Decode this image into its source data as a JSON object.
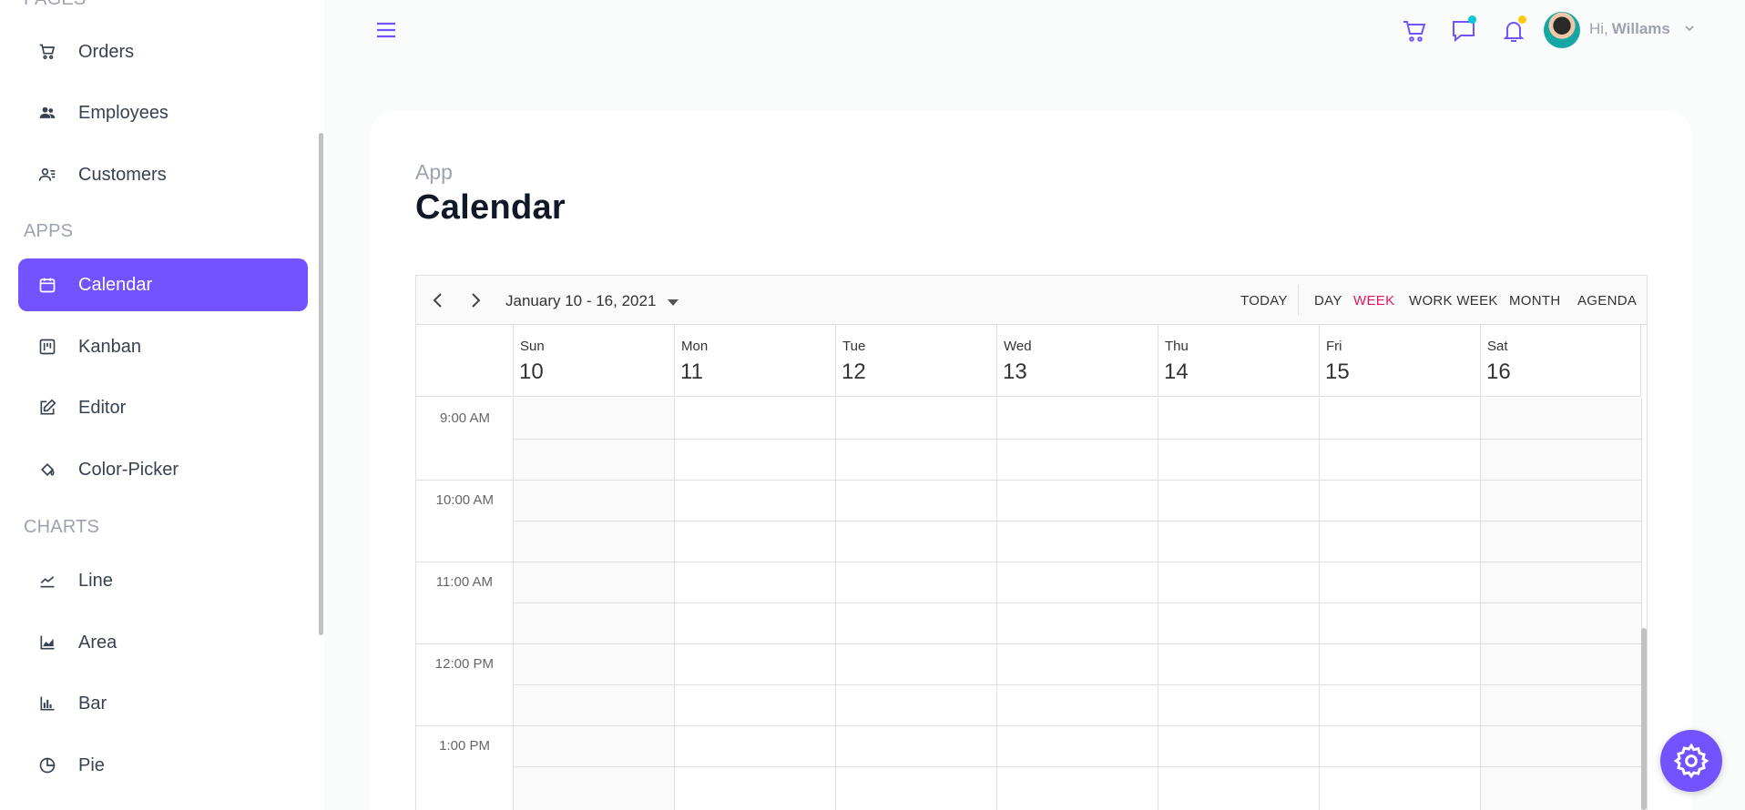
{
  "sidebar": {
    "sections": {
      "pages": "PAGES",
      "apps": "APPS",
      "charts": "CHARTS"
    },
    "items": [
      {
        "label": "Orders",
        "icon": "cart-icon"
      },
      {
        "label": "Employees",
        "icon": "employees-icon"
      },
      {
        "label": "Customers",
        "icon": "customers-icon"
      },
      {
        "label": "Calendar",
        "icon": "calendar-icon",
        "active": true
      },
      {
        "label": "Kanban",
        "icon": "kanban-icon"
      },
      {
        "label": "Editor",
        "icon": "edit-icon"
      },
      {
        "label": "Color-Picker",
        "icon": "color-picker-icon"
      },
      {
        "label": "Line",
        "icon": "line-chart-icon"
      },
      {
        "label": "Area",
        "icon": "area-chart-icon"
      },
      {
        "label": "Bar",
        "icon": "bar-chart-icon"
      },
      {
        "label": "Pie",
        "icon": "pie-chart-icon"
      }
    ]
  },
  "topbar": {
    "greeting": "Hi,",
    "user_name": "Willams",
    "chat_dot_color": "#03c9d7",
    "notification_dot_color": "#fec90f"
  },
  "page": {
    "breadcrumb": "App",
    "title": "Calendar"
  },
  "scheduler": {
    "date_range": "January 10 - 16, 2021",
    "today_label": "TODAY",
    "views": [
      "DAY",
      "WEEK",
      "WORK WEEK",
      "MONTH",
      "AGENDA"
    ],
    "active_view": "WEEK",
    "days": [
      {
        "name": "Sun",
        "date": "10"
      },
      {
        "name": "Mon",
        "date": "11"
      },
      {
        "name": "Tue",
        "date": "12"
      },
      {
        "name": "Wed",
        "date": "13"
      },
      {
        "name": "Thu",
        "date": "14"
      },
      {
        "name": "Fri",
        "date": "15"
      },
      {
        "name": "Sat",
        "date": "16"
      }
    ],
    "times": [
      "9:00 AM",
      "10:00 AM",
      "11:00 AM",
      "12:00 PM",
      "1:00 PM"
    ]
  },
  "colors": {
    "accent": "#7352ff",
    "active_view": "#e3165b"
  }
}
